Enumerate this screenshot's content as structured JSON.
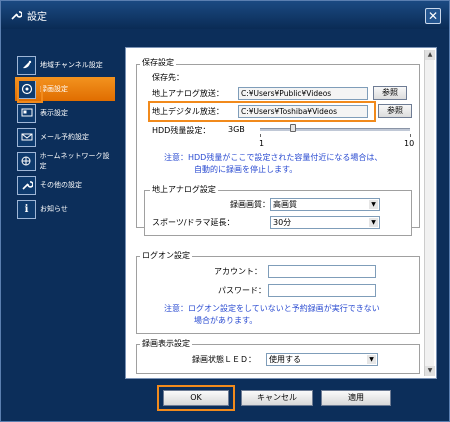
{
  "window": {
    "title": "設定",
    "close_label": "✕"
  },
  "sidebar": {
    "items": [
      {
        "label": "地域チャンネル設定",
        "icon": "satellite-icon"
      },
      {
        "label": "録画設定",
        "icon": "record-icon",
        "active": true
      },
      {
        "label": "表示設定",
        "icon": "display-icon"
      },
      {
        "label": "メール予約設定",
        "icon": "mail-icon"
      },
      {
        "label": "ホームネットワーク設定",
        "icon": "network-icon"
      },
      {
        "label": "その他の設定",
        "icon": "wrench-icon"
      },
      {
        "label": "お知らせ",
        "icon": "info-icon"
      }
    ]
  },
  "storage": {
    "group_title": "保存設定",
    "dest_label": "保存先：",
    "analog_label": "地上アナログ放送：",
    "analog_path": "C:¥Users¥Public¥Videos",
    "analog_browse": "参照",
    "digital_label": "地上デジタル放送：",
    "digital_path": "C:¥Users¥Toshiba¥Videos",
    "digital_browse": "参照",
    "hdd_label": "HDD残量設定：",
    "hdd_value": "3GB",
    "slider_min": "1",
    "slider_max": "10",
    "slider_fraction": 0.22,
    "note_line1": "注意：HDD残量がここで設定された容量付近になる場合は、",
    "note_line2": "自動的に録画を停止します。"
  },
  "analog": {
    "group_title": "地上アナログ設定",
    "quality_label": "録画画質：",
    "quality_value": "高画質",
    "extend_label": "スポーツ/ドラマ延長：",
    "extend_value": "30分"
  },
  "logon": {
    "group_title": "ログオン設定",
    "account_label": "アカウント：",
    "account_value": "",
    "password_label": "パスワード：",
    "password_value": "",
    "note_line1": "注意：ログオン設定をしていないと予約録画が実行できない",
    "note_line2": "場合があります。"
  },
  "recdisplay": {
    "group_title": "録画表示設定",
    "led_label": "録画状態ＬＥＤ：",
    "led_value": "使用する"
  },
  "buttons": {
    "ok": "OK",
    "cancel": "キャンセル",
    "apply": "適用"
  },
  "colors": {
    "highlight": "#f18a1c",
    "note": "#2a4bd1",
    "window_bg": "#0c2e5a"
  }
}
